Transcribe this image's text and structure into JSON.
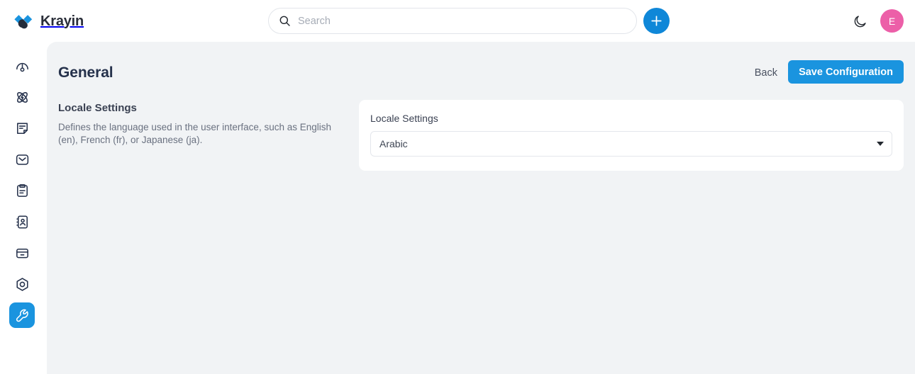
{
  "app": {
    "brand_name": "Krayin",
    "logo_icon": "krayin-diamond-logo",
    "accent_color": "#1a94df",
    "avatar_color": "#ec5fa8"
  },
  "topbar": {
    "search": {
      "icon": "search-icon",
      "placeholder": "Search",
      "value": ""
    },
    "add_button_icon": "plus-icon",
    "theme_toggle_icon": "moon-icon",
    "avatar_initial": "E"
  },
  "sidebar": {
    "items": [
      {
        "icon": "dashboard-gauge-icon",
        "name": "dashboard",
        "active": false
      },
      {
        "icon": "activity-atom-icon",
        "name": "activities",
        "active": false
      },
      {
        "icon": "note-document-icon",
        "name": "leads",
        "active": false
      },
      {
        "icon": "mail-envelope-icon",
        "name": "mail",
        "active": false
      },
      {
        "icon": "clipboard-icon",
        "name": "quotes",
        "active": false
      },
      {
        "icon": "contact-book-icon",
        "name": "contacts",
        "active": false
      },
      {
        "icon": "box-product-icon",
        "name": "products",
        "active": false
      },
      {
        "icon": "hexagon-target-icon",
        "name": "settings",
        "active": false
      },
      {
        "icon": "wrench-icon",
        "name": "configuration",
        "active": true
      }
    ]
  },
  "page": {
    "title": "General",
    "back_label": "Back",
    "save_label": "Save Configuration"
  },
  "section": {
    "title": "Locale Settings",
    "description": "Defines the language used in the user interface, such as English (en), French (fr), or Japanese (ja)."
  },
  "field": {
    "label": "Locale Settings",
    "selected_value": "Arabic",
    "caret_icon": "chevron-down-icon",
    "options": [
      "Arabic"
    ]
  }
}
